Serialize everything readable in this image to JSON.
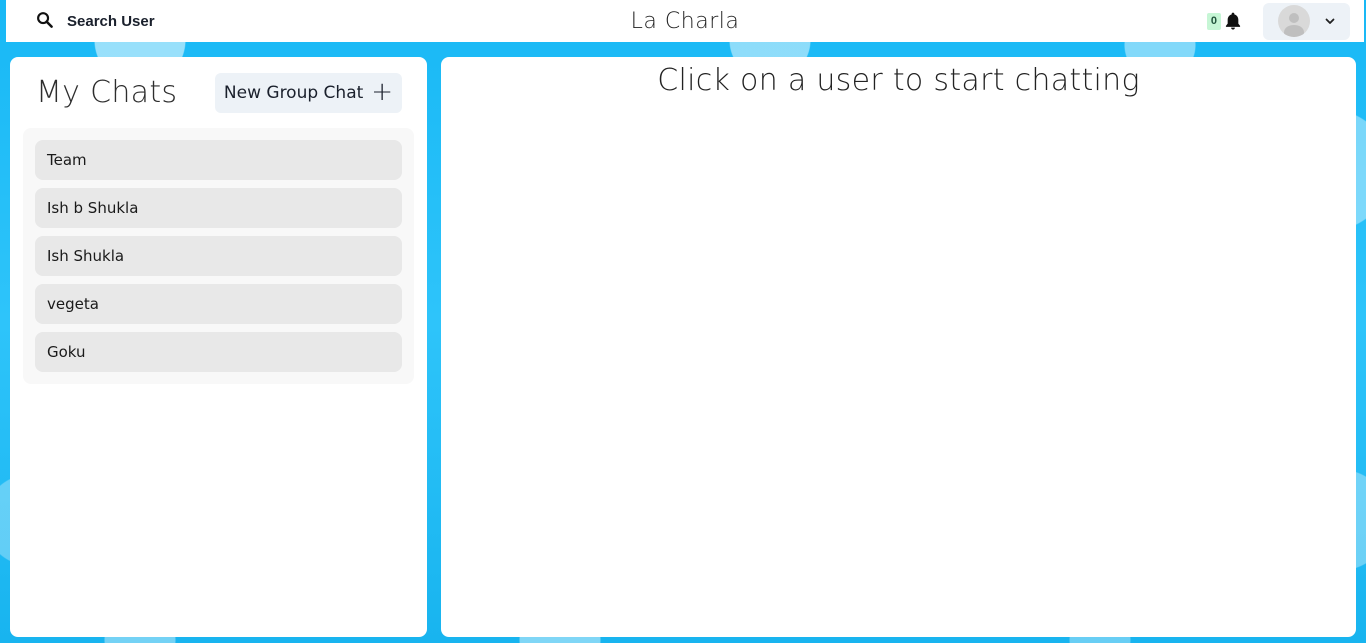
{
  "header": {
    "search_label": "Search User",
    "app_title": "La Charla",
    "notification_count": "0"
  },
  "sidebar": {
    "title": "My Chats",
    "new_group_label": "New Group Chat",
    "new_group_icon": "+",
    "chats": [
      {
        "name": "Team"
      },
      {
        "name": "Ish b Shukla"
      },
      {
        "name": "Ish Shukla"
      },
      {
        "name": "vegeta"
      },
      {
        "name": "Goku"
      }
    ]
  },
  "main": {
    "empty_message": "Click on a user to start chatting"
  },
  "colors": {
    "background": "#1cbdf5",
    "button_bg": "#edf2f7",
    "chat_item_bg": "#e8e8e8",
    "badge_bg": "#c6f6d5"
  }
}
